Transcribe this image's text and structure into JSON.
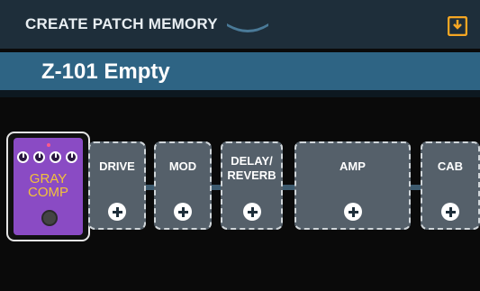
{
  "header": {
    "title": "CREATE PATCH MEMORY"
  },
  "patch": {
    "name": "Z-101 Empty"
  },
  "effect": {
    "name_line1": "GRAY",
    "name_line2": "COMP",
    "color": "#8a4bc4"
  },
  "slots": [
    {
      "label": "DRIVE"
    },
    {
      "label": "MOD"
    },
    {
      "label": "DELAY/\nREVERB"
    },
    {
      "label": "AMP"
    },
    {
      "label": "CAB"
    }
  ],
  "colors": {
    "header_bg": "#1e2e3a",
    "namebar_bg": "#2e6484",
    "slot_bg": "#55606a",
    "save_icon": "#f5a623"
  },
  "icons": {
    "save": "save-icon",
    "add": "plus-circle-icon"
  }
}
